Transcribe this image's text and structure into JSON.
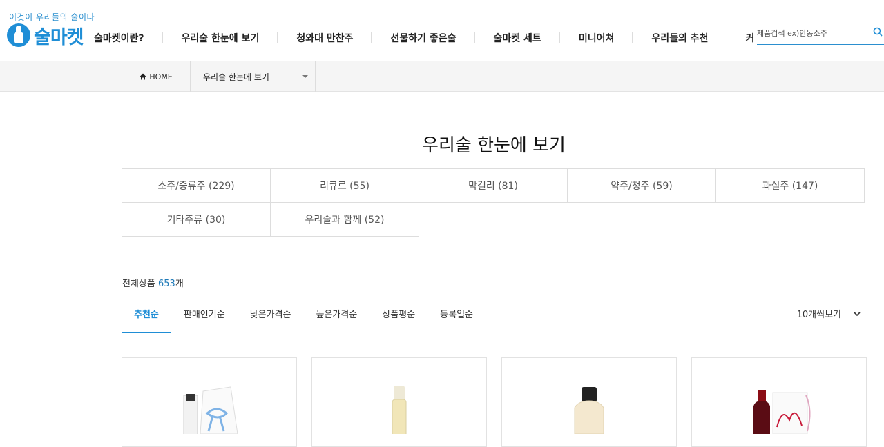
{
  "header": {
    "tagline": "이것이 우리들의 술이다",
    "logo_text": "술마켓",
    "nav": [
      "술마켓이란?",
      "우리술 한눈에 보기",
      "청와대 만찬주",
      "선물하기 좋은술",
      "술마켓 세트",
      "미니어쳐",
      "우리들의 추천",
      "커"
    ],
    "search_placeholder": "제품검색 ex)안동소주"
  },
  "breadcrumb": {
    "home": "HOME",
    "current": "우리술 한눈에 보기"
  },
  "page_title": "우리술 한눈에 보기",
  "categories": [
    "소주/증류주 (229)",
    "리큐르 (55)",
    "막걸리 (81)",
    "약주/청주 (59)",
    "과실주 (147)",
    "기타주류 (30)",
    "우리술과 함께 (52)"
  ],
  "total": {
    "label": "전체상품",
    "count": "653",
    "unit": "개"
  },
  "sort_tabs": [
    "추천순",
    "판매인기순",
    "낮은가격순",
    "높은가격순",
    "상품평순",
    "등록일순"
  ],
  "per_page": "10개씩보기",
  "products": [
    {
      "image": "white-bottle-with-blue-ribbon-icon"
    },
    {
      "image": "clear-liquor-bottle-icon"
    },
    {
      "image": "makgeolli-bottle-icon"
    },
    {
      "image": "red-wine-bottle-icon"
    }
  ],
  "colors": {
    "accent": "#1f8ed6",
    "border": "#dddddd",
    "crumb_bg": "#f5f5f5"
  }
}
